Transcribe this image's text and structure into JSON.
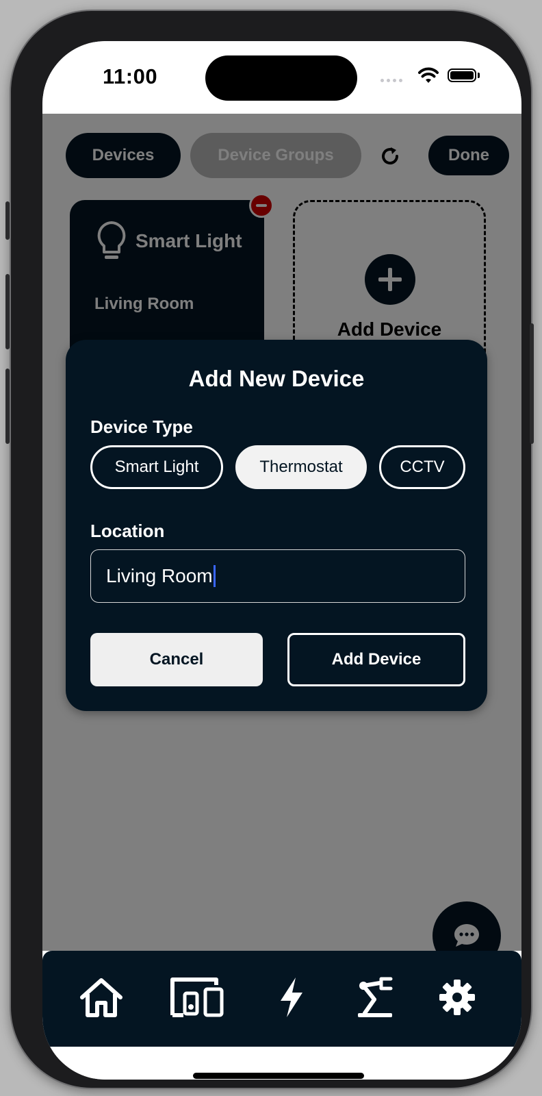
{
  "status_bar": {
    "time": "11:00"
  },
  "top_bar": {
    "devices_label": "Devices",
    "groups_label": "Device Groups",
    "done_label": "Done"
  },
  "device_card": {
    "name": "Smart Light",
    "location": "Living Room"
  },
  "add_card": {
    "label": "Add Device"
  },
  "modal": {
    "title": "Add New Device",
    "device_type_label": "Device Type",
    "device_types": [
      {
        "label": "Smart Light",
        "selected": false
      },
      {
        "label": "Thermostat",
        "selected": true
      },
      {
        "label": "CCTV",
        "selected": false
      }
    ],
    "location_label": "Location",
    "location_value": "Living Room",
    "cancel_label": "Cancel",
    "add_label": "Add Device"
  },
  "bottom_nav": {
    "items": [
      {
        "icon": "home-icon"
      },
      {
        "icon": "devices-icon"
      },
      {
        "icon": "energy-icon"
      },
      {
        "icon": "robot-arm-icon"
      },
      {
        "icon": "settings-icon"
      }
    ]
  },
  "colors": {
    "primary": "#041522",
    "danger": "#d00000",
    "chip_selected_bg": "#f2f2f2",
    "caret": "#3a66ff"
  }
}
